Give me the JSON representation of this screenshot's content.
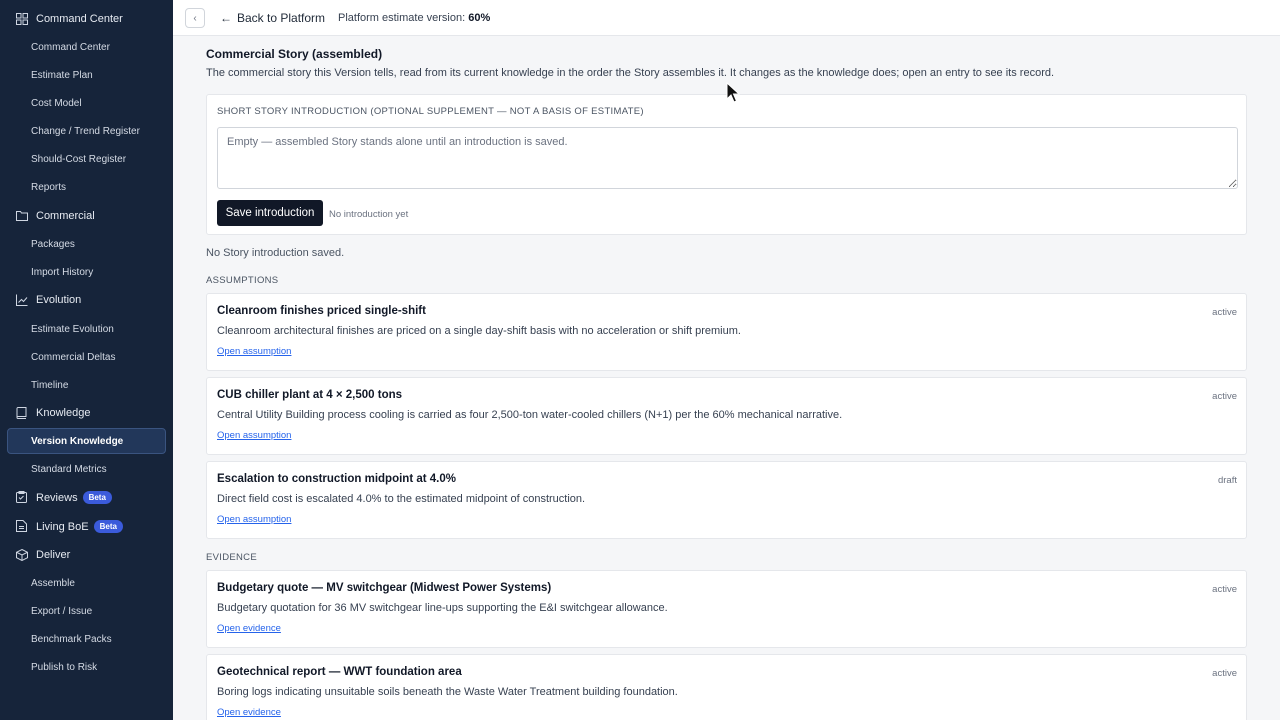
{
  "sidebar": {
    "groups": [
      {
        "label": "Command Center",
        "icon": "grid-icon"
      },
      {
        "label": "Commercial",
        "icon": "folder-icon"
      },
      {
        "label": "Evolution",
        "icon": "chart-line-icon"
      },
      {
        "label": "Knowledge",
        "icon": "book-icon"
      },
      {
        "label": "Reviews",
        "icon": "clipboard-icon",
        "badge": "Beta"
      },
      {
        "label": "Living BoE",
        "icon": "document-icon",
        "badge": "Beta"
      },
      {
        "label": "Deliver",
        "icon": "package-icon"
      }
    ],
    "items": {
      "command_center": "Command Center",
      "estimate_plan": "Estimate Plan",
      "cost_model": "Cost Model",
      "change_trend": "Change / Trend Register",
      "should_cost": "Should-Cost Register",
      "reports": "Reports",
      "packages": "Packages",
      "import_history": "Import History",
      "estimate_evolution": "Estimate Evolution",
      "commercial_deltas": "Commercial Deltas",
      "timeline": "Timeline",
      "version_knowledge": "Version Knowledge",
      "standard_metrics": "Standard Metrics",
      "assemble": "Assemble",
      "export_issue": "Export / Issue",
      "benchmark_packs": "Benchmark Packs",
      "publish_to_risk": "Publish to Risk"
    }
  },
  "topbar": {
    "collapse_glyph": "‹",
    "back_label": "Back to Platform",
    "back_arrow": "←",
    "version_label": "Platform estimate version:",
    "version_value": "60%"
  },
  "story": {
    "title": "Commercial Story (assembled)",
    "description": "The commercial story this Version tells, read from its current knowledge in the order the Story assembles it. It changes as the knowledge does; open an entry to see its record.",
    "intro": {
      "label": "SHORT STORY INTRODUCTION (OPTIONAL SUPPLEMENT — NOT A BASIS OF ESTIMATE)",
      "placeholder": "Empty — assembled Story stands alone until an introduction is saved.",
      "save_label": "Save introduction",
      "status": "No introduction yet"
    },
    "saved_note": "No Story introduction saved."
  },
  "assumptions": {
    "heading": "ASSUMPTIONS",
    "entries": [
      {
        "title": "Cleanroom finishes priced single-shift",
        "description": "Cleanroom architectural finishes are priced on a single day-shift basis with no acceleration or shift premium.",
        "link": "Open assumption",
        "status": "active"
      },
      {
        "title": "CUB chiller plant at 4 × 2,500 tons",
        "description": "Central Utility Building process cooling is carried as four 2,500-ton water-cooled chillers (N+1) per the 60% mechanical narrative.",
        "link": "Open assumption",
        "status": "active"
      },
      {
        "title": "Escalation to construction midpoint at 4.0%",
        "description": "Direct field cost is escalated 4.0% to the estimated midpoint of construction.",
        "link": "Open assumption",
        "status": "draft"
      }
    ]
  },
  "evidence": {
    "heading": "EVIDENCE",
    "entries": [
      {
        "title": "Budgetary quote — MV switchgear (Midwest Power Systems)",
        "description": "Budgetary quotation for 36 MV switchgear line-ups supporting the E&I switchgear allowance.",
        "link": "Open evidence",
        "status": "active"
      },
      {
        "title": "Geotechnical report — WWT foundation area",
        "description": "Boring logs indicating unsuitable soils beneath the Waste Water Treatment building foundation.",
        "link": "Open evidence",
        "status": "active"
      }
    ]
  },
  "colors": {
    "sidebar_bg": "#16243a",
    "primary_button": "#111827",
    "link": "#2563eb"
  }
}
